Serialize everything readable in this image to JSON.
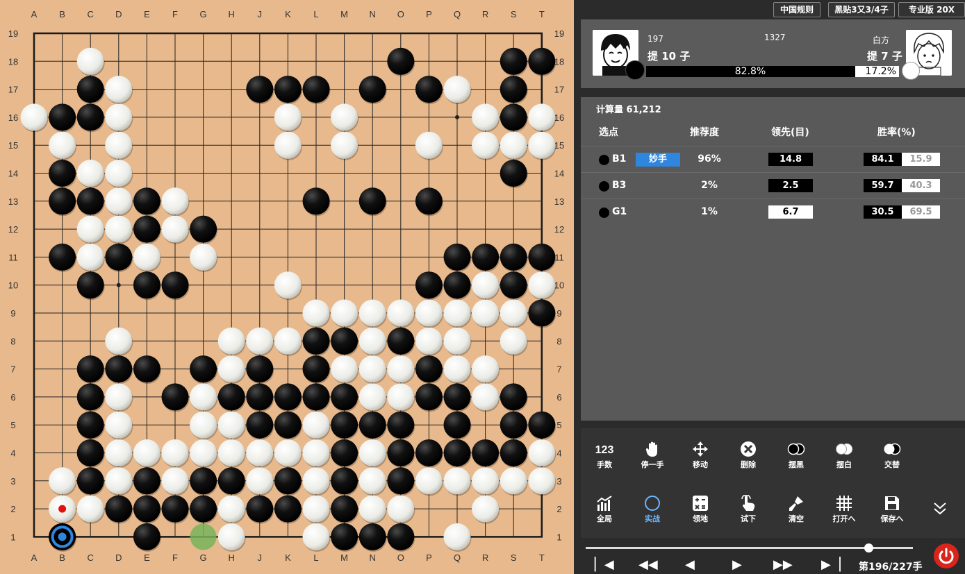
{
  "board": {
    "columns": [
      "A",
      "B",
      "C",
      "D",
      "E",
      "F",
      "G",
      "H",
      "J",
      "K",
      "L",
      "M",
      "N",
      "O",
      "P",
      "Q",
      "R",
      "S",
      "T"
    ],
    "rows": [
      "19",
      "18",
      "17",
      "16",
      "15",
      "14",
      "13",
      "12",
      "11",
      "10",
      "9",
      "8",
      "7",
      "6",
      "5",
      "4",
      "3",
      "2",
      "1"
    ],
    "stones": [
      "...................",
      "..W..........B...BB",
      "..BW....BBB.B.BW.B.B",
      "WBBW.....W.W....WBWB",
      ".W.W.....W.W..W.WWWW",
      ".BWW.............B..W",
      ".BBWBW....B.B.B.....",
      "..WWBWB.............",
      ".BWBW.W........BBBB.",
      "..B.BB...W....BBWBW.",
      "..........WWWWWWWWB.",
      "...W...WWWBBWBWW.W.W",
      "..BBB.BWB.BWWWBWW...",
      "..BW.BWBBBBBWWBBWB..",
      "..BW..WWBBWBBB.B.BB.",
      "..BWWWWWWWWBWBBBBBW.",
      ".WBWBWBBWBWBWBWWWWW.",
      ".WWBBBBWBBWBWW..W...",
      ".B..B..W..WBBB.W....."
    ],
    "last_move": "B1",
    "marker_red": "B2",
    "territory_marks": [
      "B3",
      "G1"
    ]
  },
  "top_buttons": [
    "中国规则",
    "黑贴3又3/4子",
    "专业版 20X"
  ],
  "black_player": {
    "left_num": "197",
    "captures": "提 10 子",
    "win_pct": "82.8%",
    "win_value": 0.828
  },
  "center_num": "1327",
  "white_player": {
    "name": "白方",
    "captures": "提 7 子",
    "win_pct": "17.2%"
  },
  "compute": "计算量 61,212",
  "headers": {
    "move": "选点",
    "recommend": "推荐度",
    "lead": "领先(目)",
    "winrate": "胜率(%)"
  },
  "candidates": [
    {
      "move": "B1",
      "tag": "妙手",
      "pct": "96%",
      "lead": "14.8",
      "lead_black": true,
      "wb": "84.1",
      "ww": "15.9"
    },
    {
      "move": "B3",
      "tag": "",
      "pct": "2%",
      "lead": "2.5",
      "lead_black": true,
      "wb": "59.7",
      "ww": "40.3"
    },
    {
      "move": "G1",
      "tag": "",
      "pct": "1%",
      "lead": "6.7",
      "lead_black": false,
      "wb": "30.5",
      "ww": "69.5"
    }
  ],
  "tools_row1": [
    {
      "icon": "move-number-icon",
      "label": "手数"
    },
    {
      "icon": "hand-icon",
      "label": "停一手"
    },
    {
      "icon": "move-arrows-icon",
      "label": "移动"
    },
    {
      "icon": "delete-icon",
      "label": "删除"
    },
    {
      "icon": "place-black-icon",
      "label": "摆黑"
    },
    {
      "icon": "place-white-icon",
      "label": "摆白"
    },
    {
      "icon": "alternate-icon",
      "label": "交替"
    }
  ],
  "tools_row2": [
    {
      "icon": "chart-icon",
      "label": "全局"
    },
    {
      "icon": "circle-icon",
      "label": "实战"
    },
    {
      "icon": "calculator-icon",
      "label": "领地"
    },
    {
      "icon": "pointer-icon",
      "label": "试下"
    },
    {
      "icon": "eraser-icon",
      "label": "清空"
    },
    {
      "icon": "grid-icon",
      "label": "打开へ"
    },
    {
      "icon": "save-icon",
      "label": "保存へ"
    }
  ],
  "move_counter": "第196/227手",
  "progress": 0.8634,
  "colors": {
    "board": "#e7b98c",
    "accent": "#2e86de",
    "power": "#d9251c"
  }
}
